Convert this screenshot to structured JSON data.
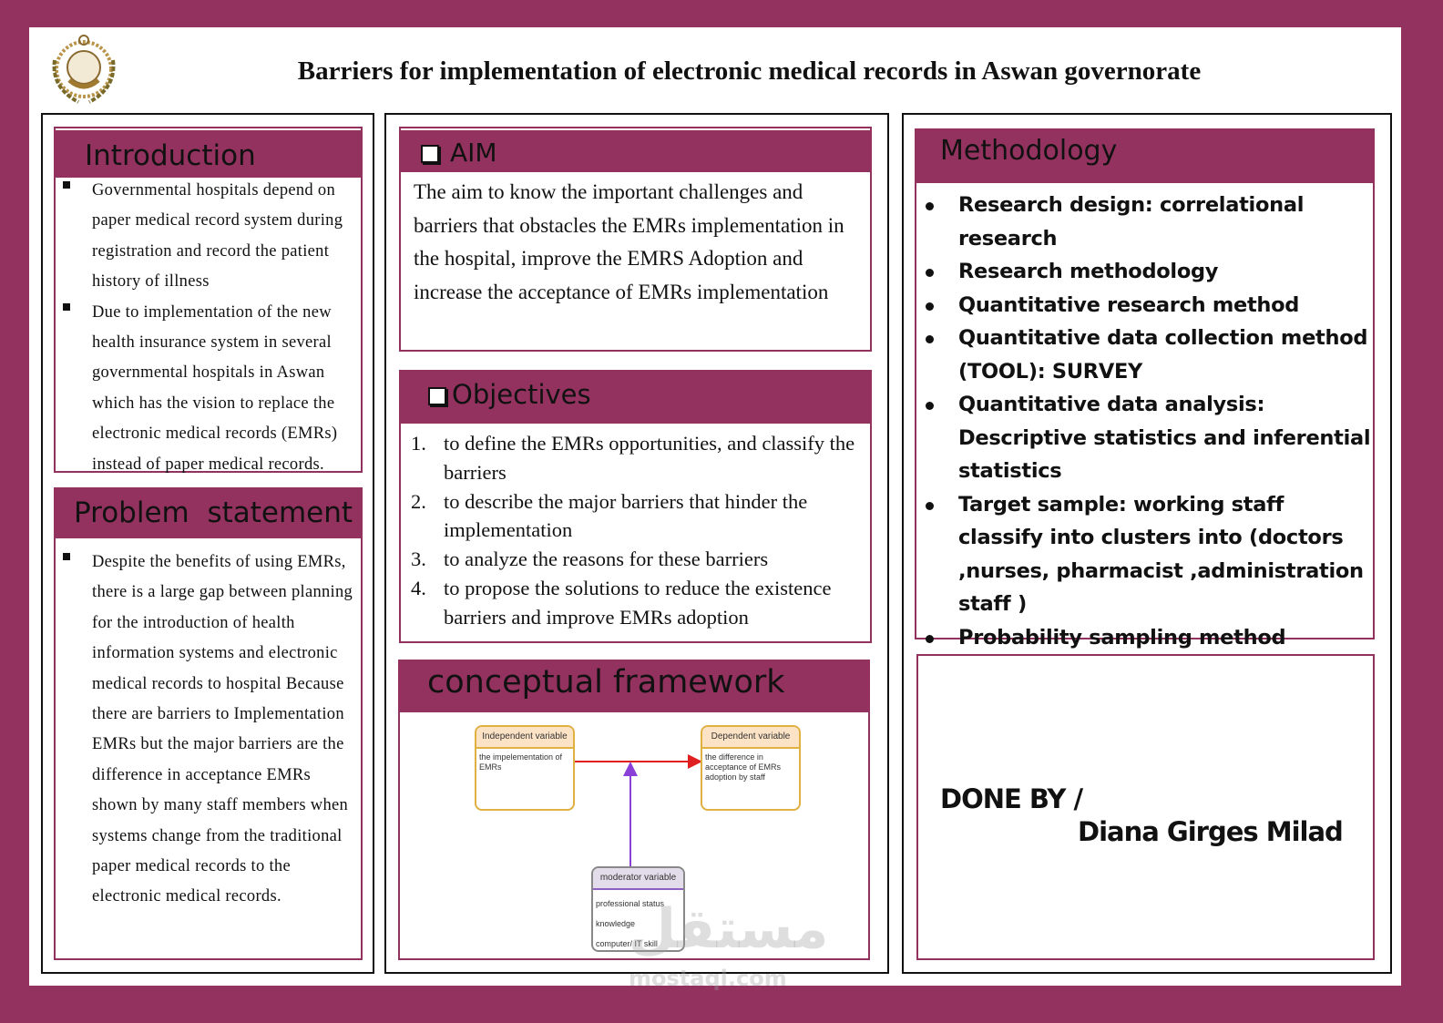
{
  "title": "Barriers for implementation of electronic medical records in Aswan governorate",
  "logo": {
    "name": "university-seal-logo",
    "text": "الأكاديمية العربية للعلوم والتكنولوجيا والنقل البحري"
  },
  "colors": {
    "brand": "#93325f",
    "background": "#ffffff"
  },
  "introduction": {
    "heading": "Introduction",
    "bullets": [
      "Governmental hospitals depend on paper medical record system during registration and record the patient history of illness",
      "Due to implementation of the new health insurance system in several governmental hospitals in Aswan which has the vision to replace the electronic medical records (EMRs) instead of paper medical records."
    ]
  },
  "problem": {
    "heading": "Problem  statement",
    "bullets": [
      "Despite the benefits of using EMRs, there is a large gap between planning for the introduction of health information systems and electronic medical records to hospital Because there are barriers to Implementation EMRs but the major barriers are the difference in acceptance EMRs shown by many staff members when systems change from the traditional paper medical records to the electronic medical records."
    ]
  },
  "aim": {
    "heading": "AIM",
    "text": "The aim to know the important challenges and barriers that obstacles the EMRs implementation in the hospital, improve the EMRS Adoption and increase the acceptance of EMRs implementation"
  },
  "objectives": {
    "heading": "Objectives",
    "items": [
      {
        "num": "1.",
        "text": "to define the EMRs opportunities, and classify the barriers"
      },
      {
        "num": "2.",
        "text": "to describe the major barriers that hinder the implementation"
      },
      {
        "num": "3.",
        "text": "to analyze the reasons for these barriers"
      },
      {
        "num": "4.",
        "text": "to propose the solutions to reduce the existence barriers and improve EMRs adoption"
      }
    ]
  },
  "framework": {
    "heading": "conceptual framework",
    "independent": {
      "title": "Independent variable",
      "body": "the impelementation of EMRs"
    },
    "dependent": {
      "title": "Dependent variable",
      "body": "the difference in acceptance of EMRs adoption by staff"
    },
    "moderator": {
      "title": "moderator variable",
      "items": [
        "professional status",
        "knowledge",
        "computer/ IT skill"
      ]
    },
    "arrow_colors": {
      "main": "#e02020",
      "moderator": "#8a3fd6"
    }
  },
  "methodology": {
    "heading": "Methodology",
    "items": [
      "Research design:  correlational research",
      "Research methodology",
      "Quantitative research method",
      "Quantitative data collection method (TOOL): SURVEY",
      "Quantitative data analysis: Descriptive statistics and inferential statistics",
      "Target sample: working staff classify into clusters into (doctors ,nurses, pharmacist ,administration staff )",
      "Probability sampling method /stratified sampling method"
    ]
  },
  "done_by": {
    "label": "DONE BY /",
    "name": "Diana Girges Milad"
  },
  "watermark": {
    "arabic": "مستقل",
    "latin": "mostaql.com"
  }
}
